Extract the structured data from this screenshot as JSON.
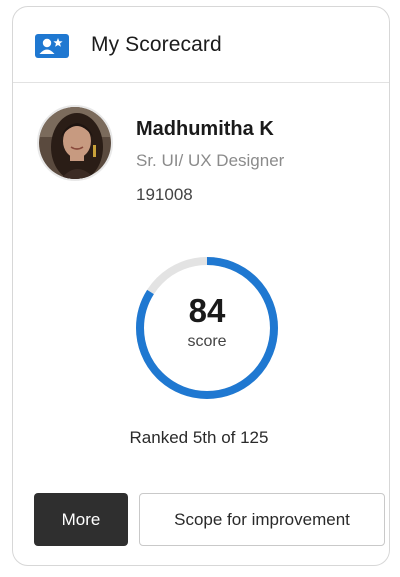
{
  "header": {
    "title": "My Scorecard",
    "icon": "user-card-icon",
    "icon_color": "#1f78d1"
  },
  "profile": {
    "avatar": "avatar",
    "name": "Madhumitha K",
    "role": "Sr. UI/ UX Designer",
    "employee_id": "191008"
  },
  "score": {
    "value": "84",
    "label": "score",
    "progress_percent": 84,
    "ring_color": "#1f78d1",
    "track_color": "#e3e3e3"
  },
  "rank_text": "Ranked 5th of 125",
  "buttons": {
    "more_label": "More",
    "scope_label": "Scope for improvement"
  }
}
